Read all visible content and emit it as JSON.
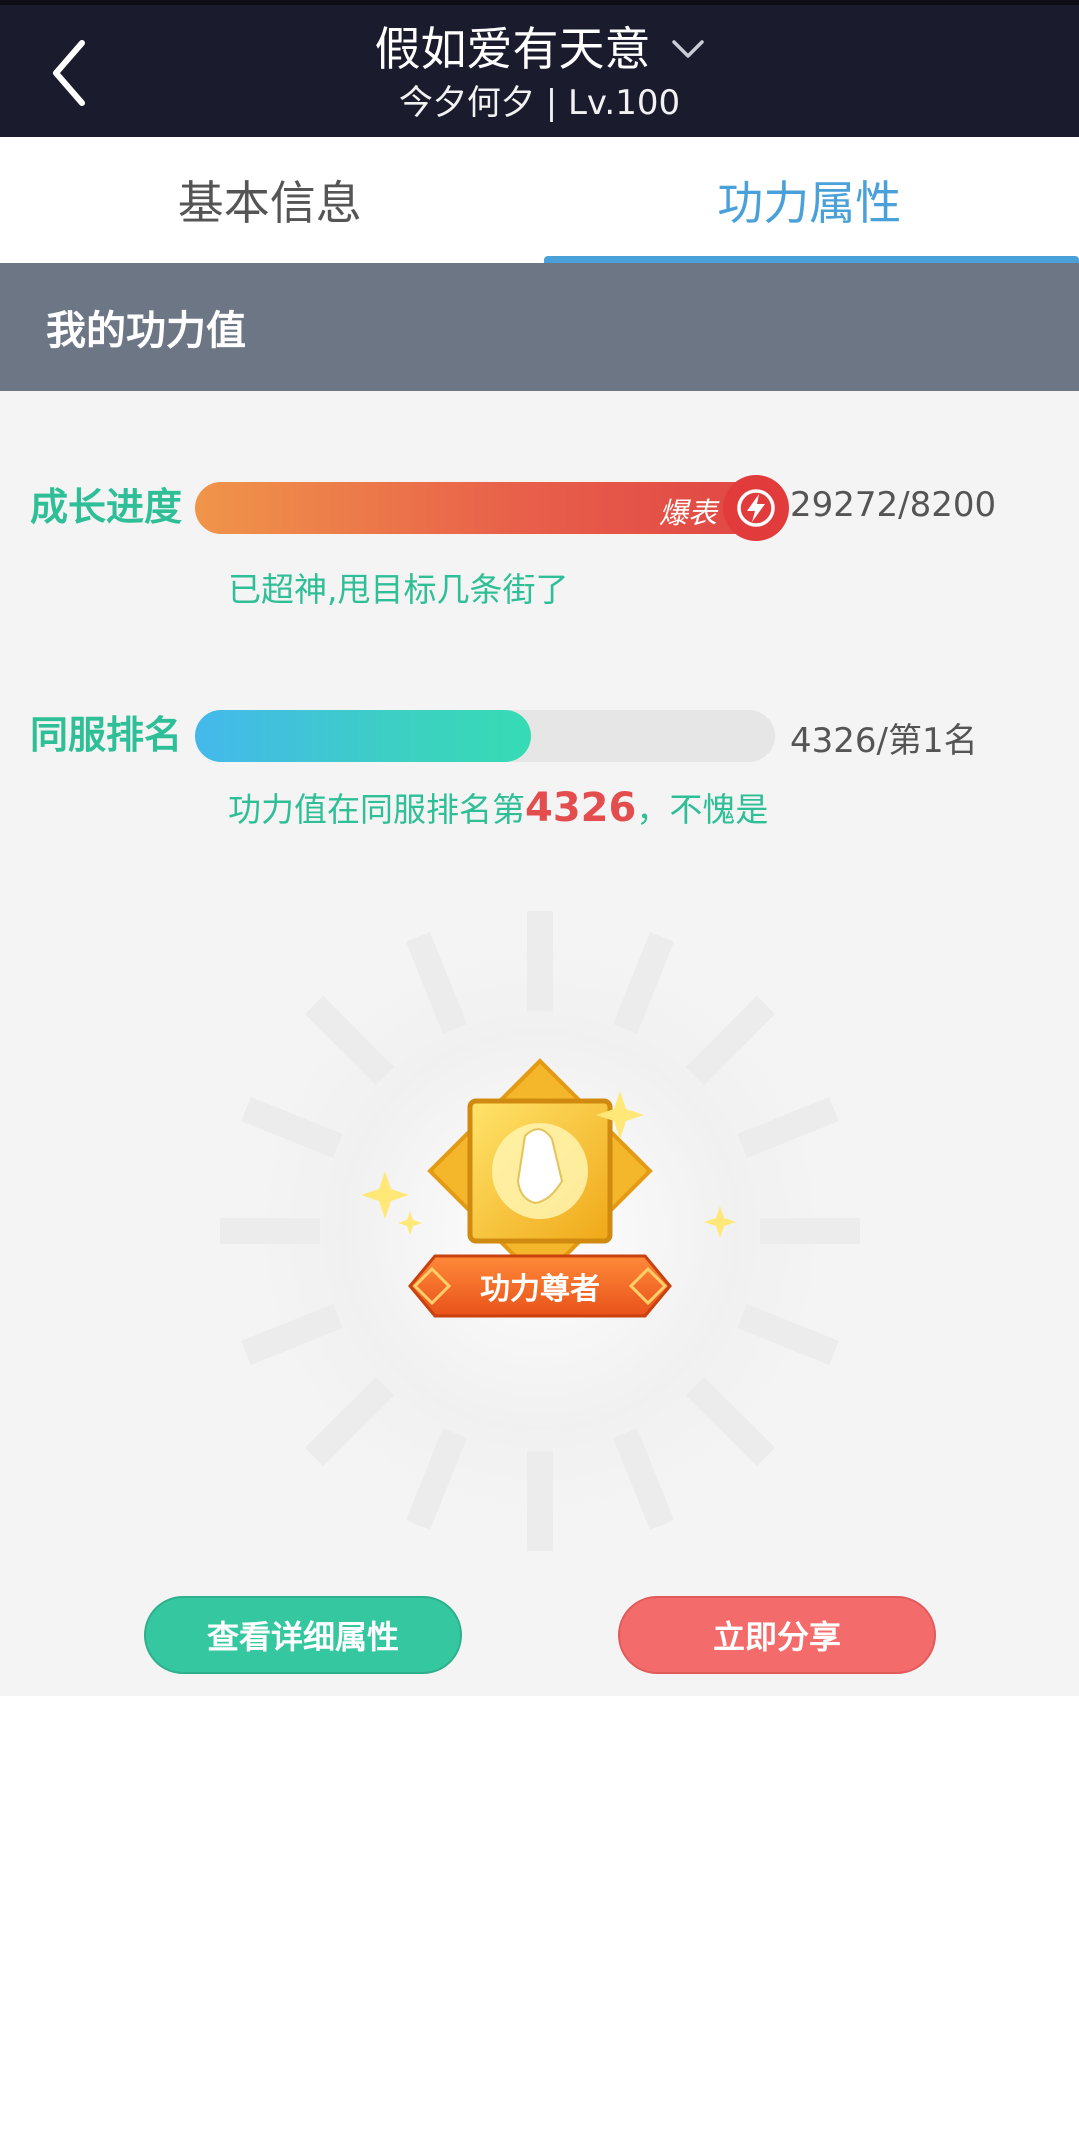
{
  "header": {
    "title": "假如爱有天意",
    "subtitle": "今夕何夕 | Lv.100"
  },
  "tabs": [
    {
      "label": "基本信息",
      "active": false
    },
    {
      "label": "功力属性",
      "active": true
    }
  ],
  "section": {
    "title": "我的功力值"
  },
  "growth": {
    "label": "成长进度",
    "badge_text": "爆表",
    "value_text": "29272/8200",
    "progress_fraction": 1.0,
    "description": "已超神,甩目标几条街了"
  },
  "rank": {
    "label": "同服排名",
    "value_text": "4326/第1名",
    "progress_fraction": 0.58,
    "description_prefix": "功力值在同服排名第",
    "description_rank": "4326",
    "description_suffix": "，不愧是"
  },
  "badge": {
    "title": "功力尊者"
  },
  "buttons": {
    "detail_label": "查看详细属性",
    "share_label": "立即分享"
  },
  "colors": {
    "header_bg": "#1a1c2e",
    "accent_blue": "#4aa0d8",
    "accent_green": "#2fbf97",
    "accent_red": "#e34d4d"
  }
}
